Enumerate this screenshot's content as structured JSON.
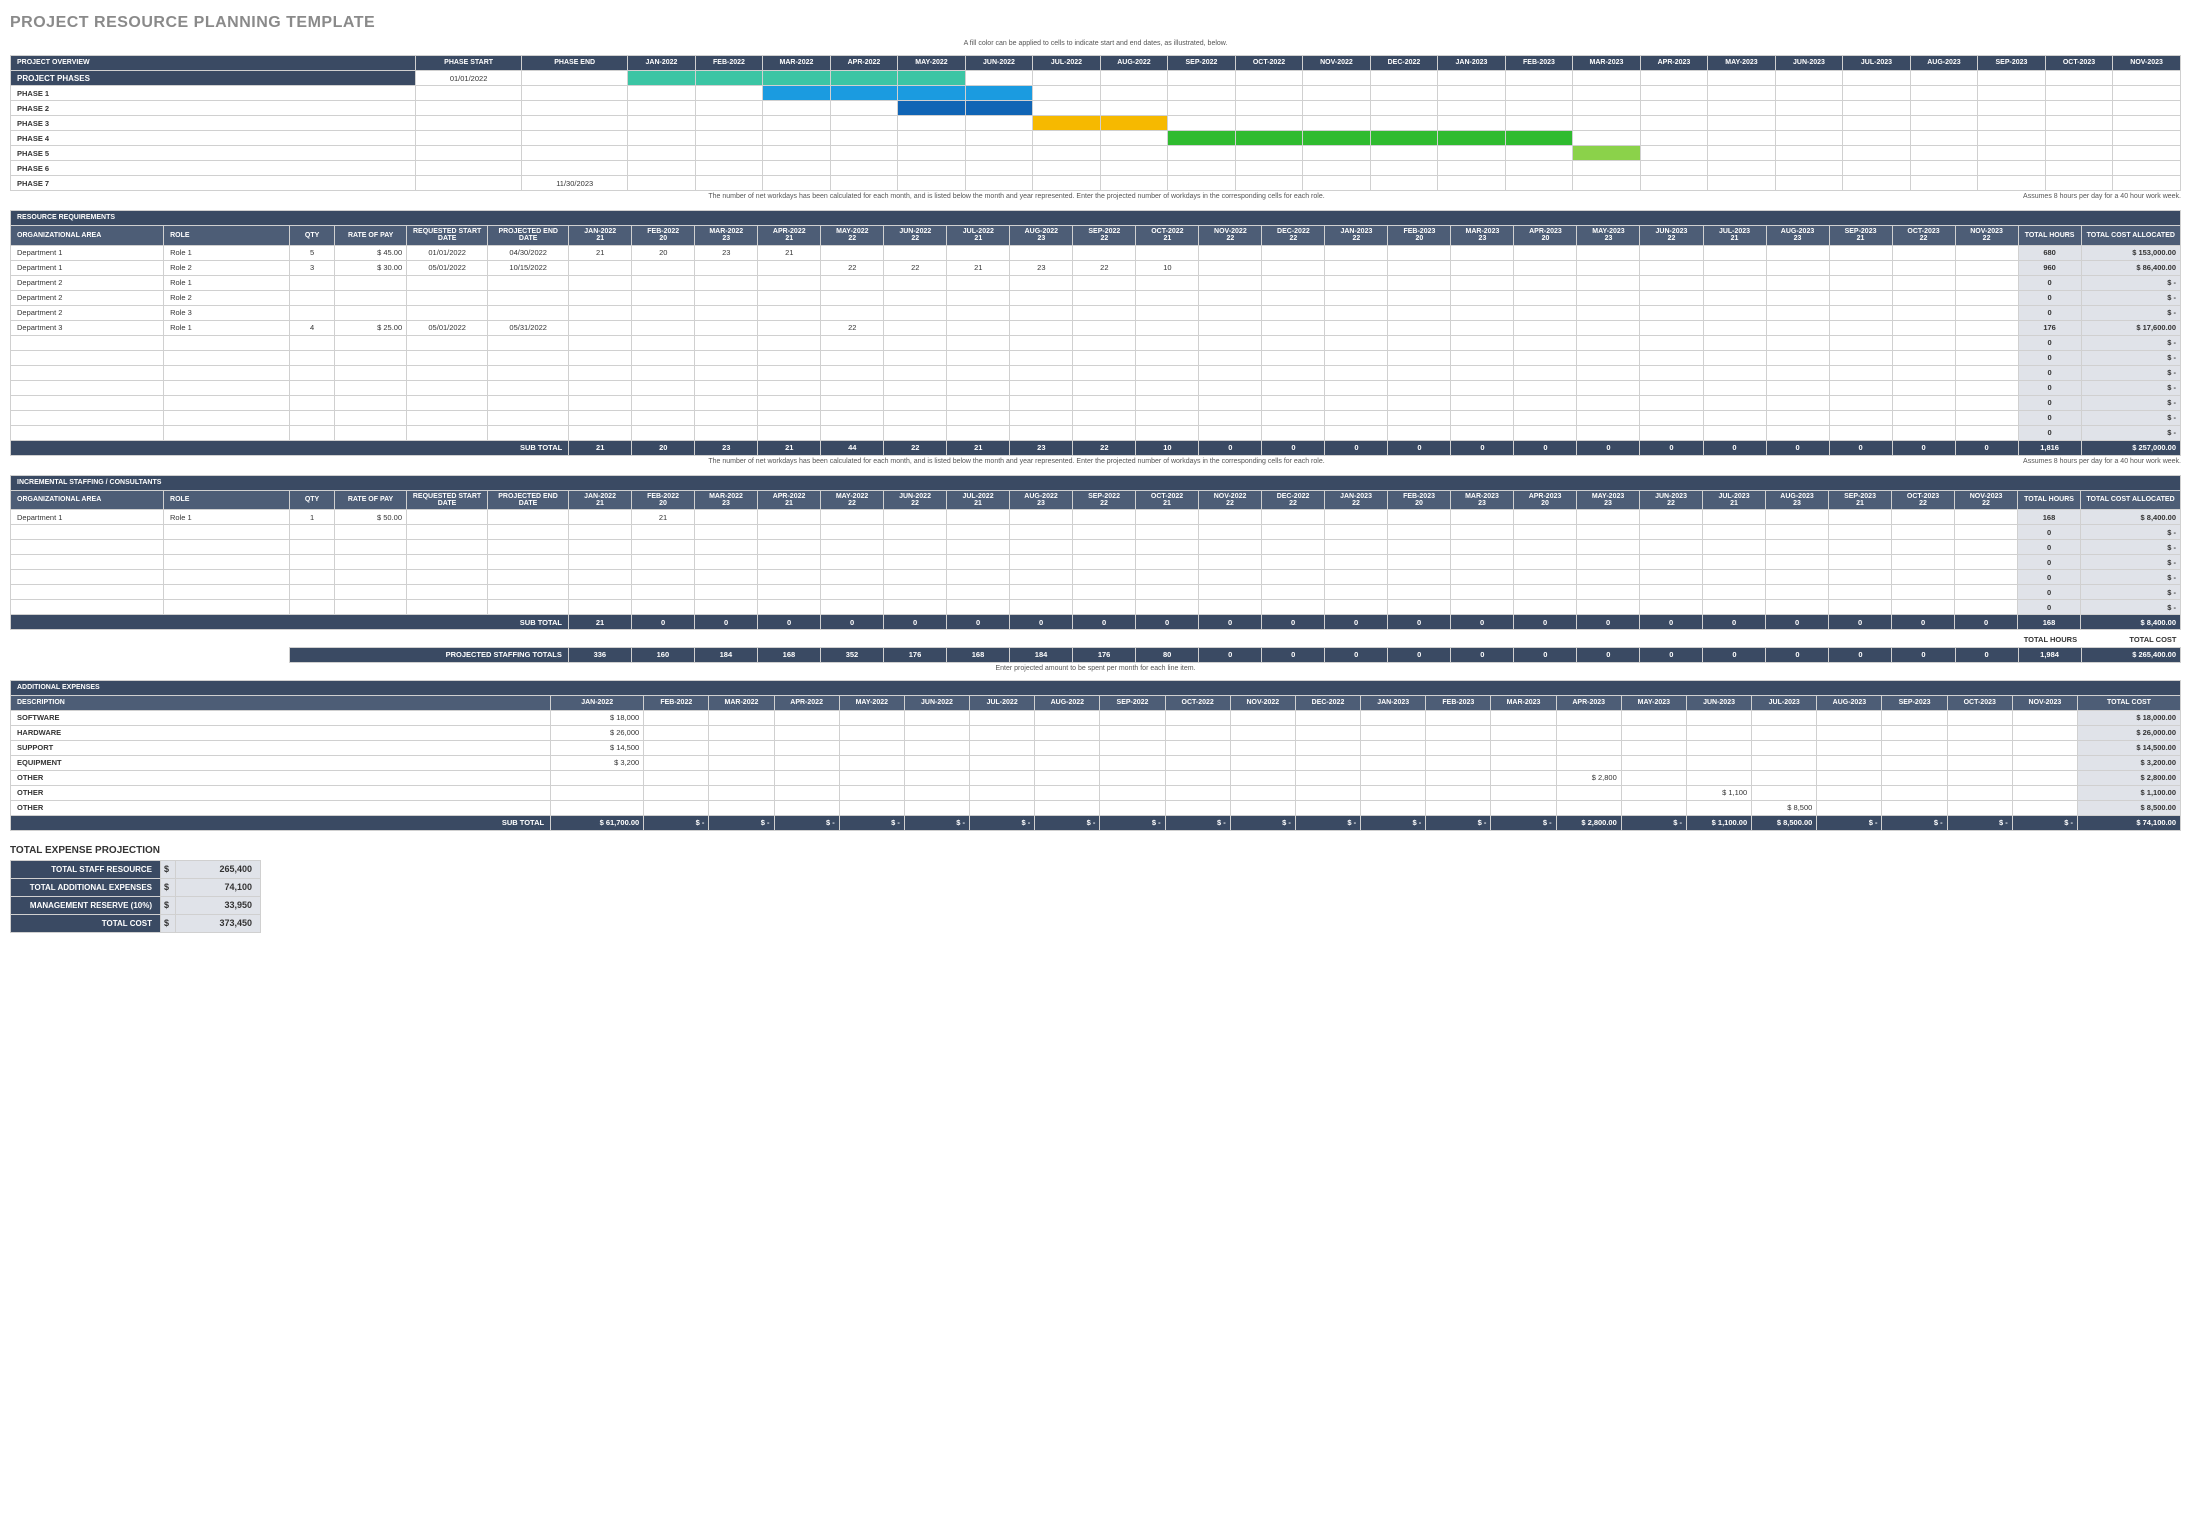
{
  "title": "PROJECT RESOURCE PLANNING TEMPLATE",
  "months": [
    "Jan-2022",
    "Feb-2022",
    "Mar-2022",
    "Apr-2022",
    "May-2022",
    "Jun-2022",
    "Jul-2022",
    "Aug-2022",
    "Sep-2022",
    "Oct-2022",
    "Nov-2022",
    "Dec-2022",
    "Jan-2023",
    "Feb-2023",
    "Mar-2023",
    "Apr-2023",
    "May-2023",
    "Jun-2023",
    "Jul-2023",
    "Aug-2023",
    "Sep-2023",
    "Oct-2023",
    "Nov-2023"
  ],
  "workdays": [
    "21",
    "20",
    "23",
    "21",
    "22",
    "22",
    "21",
    "23",
    "22",
    "21",
    "22",
    "22",
    "22",
    "20",
    "23",
    "20",
    "23",
    "22",
    "21",
    "23",
    "21",
    "22",
    "22"
  ],
  "workdays_inc": [
    "21",
    "20",
    "23",
    "21",
    "22",
    "22",
    "21",
    "23",
    "22",
    "21",
    "22",
    "22",
    "22",
    "20",
    "23",
    "20",
    "23",
    "22",
    "21",
    "23",
    "21",
    "22",
    "22"
  ],
  "notes": {
    "gantt": "A fill color can be applied to cells to indicate start and end dates, as illustrated, below.",
    "resource": "The number of net workdays has been calculated for each month, and is listed below the month and year represented. Enter the projected number of workdays in the corresponding cells for each role.",
    "assume": "Assumes 8 hours per day for a 40 hour work week.",
    "expense": "Enter projected amount to be spent per month for each line item."
  },
  "overview": {
    "header": "PROJECT OVERVIEW",
    "cols": {
      "start": "PHASE START",
      "end": "PHASE END"
    },
    "phases_label": "PROJECT PHASES",
    "phases_start": "01/01/2022",
    "rows": [
      {
        "name": "PHASE 1",
        "start": "",
        "end": "",
        "fill": {
          "from": 2,
          "to": 5,
          "class": "g-blue"
        }
      },
      {
        "name": "PHASE 2",
        "start": "",
        "end": "",
        "fill": {
          "from": 4,
          "to": 5,
          "class": "g-dblue"
        }
      },
      {
        "name": "PHASE 3",
        "start": "",
        "end": "",
        "fill": {
          "from": 6,
          "to": 7,
          "class": "g-yellow"
        }
      },
      {
        "name": "PHASE 4",
        "start": "",
        "end": "",
        "fill": {
          "from": 8,
          "to": 13,
          "class": "g-lime"
        }
      },
      {
        "name": "PHASE 5",
        "start": "",
        "end": "",
        "fill": {
          "from": 14,
          "to": 14,
          "class": "g-lgreen"
        }
      },
      {
        "name": "PHASE 6",
        "start": "",
        "end": ""
      },
      {
        "name": "PHASE 7",
        "start": "",
        "end": "11/30/2023"
      }
    ],
    "phases_fill": {
      "from": 0,
      "to": 4,
      "class": "g-green"
    }
  },
  "resource": {
    "header": "RESOURCE REQUIREMENTS",
    "cols": {
      "org": "ORGANIZATIONAL AREA",
      "role": "ROLE",
      "qty": "QTY",
      "rate": "RATE of PAY",
      "reqstart": "REQUESTED START DATE",
      "projend": "PROJECTED END DATE",
      "thours": "TOTAL HOURS",
      "tcost": "TOTAL COST ALLOCATED"
    },
    "rows": [
      {
        "org": "Department 1",
        "role": "Role 1",
        "qty": "5",
        "rate": "45.00",
        "rstart": "01/01/2022",
        "pend": "04/30/2022",
        "vals": {
          "0": "21",
          "1": "20",
          "2": "23",
          "3": "21"
        },
        "hours": "680",
        "cost": "153,000.00"
      },
      {
        "org": "Department 1",
        "role": "Role 2",
        "qty": "3",
        "rate": "30.00",
        "rstart": "05/01/2022",
        "pend": "10/15/2022",
        "vals": {
          "4": "22",
          "5": "22",
          "6": "21",
          "7": "23",
          "8": "22",
          "9": "10"
        },
        "hours": "960",
        "cost": "86,400.00"
      },
      {
        "org": "Department 2",
        "role": "Role 1",
        "hours": "0",
        "cost": "-"
      },
      {
        "org": "Department 2",
        "role": "Role 2",
        "hours": "0",
        "cost": "-"
      },
      {
        "org": "Department 2",
        "role": "Role 3",
        "hours": "0",
        "cost": "-"
      },
      {
        "org": "Department 3",
        "role": "Role 1",
        "qty": "4",
        "rate": "25.00",
        "rstart": "05/01/2022",
        "pend": "05/31/2022",
        "vals": {
          "4": "22"
        },
        "hours": "176",
        "cost": "17,600.00"
      },
      {
        "hours": "0",
        "cost": "-"
      },
      {
        "hours": "0",
        "cost": "-"
      },
      {
        "hours": "0",
        "cost": "-"
      },
      {
        "hours": "0",
        "cost": "-"
      },
      {
        "hours": "0",
        "cost": "-"
      },
      {
        "hours": "0",
        "cost": "-"
      },
      {
        "hours": "0",
        "cost": "-"
      }
    ],
    "subtotal_label": "SUB TOTAL",
    "subtotal": [
      "21",
      "20",
      "23",
      "21",
      "44",
      "22",
      "21",
      "23",
      "22",
      "10",
      "0",
      "0",
      "0",
      "0",
      "0",
      "0",
      "0",
      "0",
      "0",
      "0",
      "0",
      "0",
      "0"
    ],
    "subtotal_hours": "1,816",
    "subtotal_cost": "257,000.00"
  },
  "incremental": {
    "header": "INCREMENTAL STAFFING / CONSULTANTS",
    "rows": [
      {
        "org": "Department 1",
        "role": "Role 1",
        "qty": "1",
        "rate": "50.00",
        "vals": {
          "1": "21"
        },
        "hours": "168",
        "cost": "8,400.00"
      },
      {
        "hours": "0",
        "cost": "-"
      },
      {
        "hours": "0",
        "cost": "-"
      },
      {
        "hours": "0",
        "cost": "-"
      },
      {
        "hours": "0",
        "cost": "-"
      },
      {
        "hours": "0",
        "cost": "-"
      },
      {
        "hours": "0",
        "cost": "-"
      }
    ],
    "subtotal": [
      "21",
      "0",
      "0",
      "0",
      "0",
      "0",
      "0",
      "0",
      "0",
      "0",
      "0",
      "0",
      "0",
      "0",
      "0",
      "0",
      "0",
      "0",
      "0",
      "0",
      "0",
      "0",
      "0"
    ],
    "subtotal_hours": "168",
    "subtotal_cost": "8,400.00",
    "grand_lbl": "PROJECTED STAFFING TOTALS",
    "grand": [
      "336",
      "160",
      "184",
      "168",
      "352",
      "176",
      "168",
      "184",
      "176",
      "80",
      "0",
      "0",
      "0",
      "0",
      "0",
      "0",
      "0",
      "0",
      "0",
      "0",
      "0",
      "0",
      "0"
    ],
    "grand_hours": "1,984",
    "grand_cost": "265,400.00",
    "col_hours": "TOTAL HOURS",
    "col_cost": "TOTAL COST"
  },
  "expenses": {
    "header": "ADDITIONAL EXPENSES",
    "desc": "DESCRIPTION",
    "tcost": "TOTAL COST",
    "rows": [
      {
        "name": "SOFTWARE",
        "vals": {
          "0": "18,000"
        },
        "total": "18,000.00"
      },
      {
        "name": "HARDWARE",
        "vals": {
          "0": "26,000"
        },
        "total": "26,000.00"
      },
      {
        "name": "SUPPORT",
        "vals": {
          "0": "14,500"
        },
        "total": "14,500.00"
      },
      {
        "name": "EQUIPMENT",
        "vals": {
          "0": "3,200"
        },
        "total": "3,200.00"
      },
      {
        "name": "OTHER",
        "vals": {
          "15": "2,800"
        },
        "total": "2,800.00"
      },
      {
        "name": "OTHER",
        "vals": {
          "17": "1,100"
        },
        "total": "1,100.00"
      },
      {
        "name": "OTHER",
        "vals": {
          "18": "8,500"
        },
        "total": "8,500.00"
      }
    ],
    "subtotal": [
      "$ 61,700.00",
      "$    -",
      "$    -",
      "$    -",
      "$    -",
      "$    -",
      "$    -",
      "$    -",
      "$    -",
      "$    -",
      "$    -",
      "$    -",
      "$    -",
      "$    -",
      "$    -",
      "$ 2,800.00",
      "$    -",
      "$ 1,100.00",
      "$ 8,500.00",
      "$    -",
      "$    -",
      "$    -",
      "$    -"
    ],
    "subtotal_total": "74,100.00"
  },
  "summary": {
    "header": "TOTAL EXPENSE PROJECTION",
    "rows": [
      {
        "lbl": "TOTAL STAFF RESOURCE",
        "val": "265,400"
      },
      {
        "lbl": "TOTAL ADDITIONAL EXPENSES",
        "val": "74,100"
      },
      {
        "lbl": "MANAGEMENT RESERVE (10%)",
        "val": "33,950"
      },
      {
        "lbl": "TOTAL COST",
        "val": "373,450"
      }
    ]
  }
}
